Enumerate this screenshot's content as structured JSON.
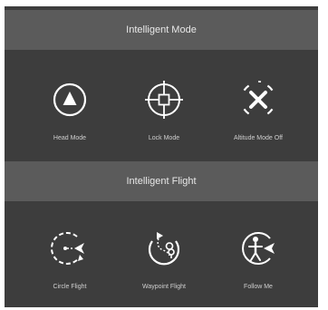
{
  "intelligent_mode": {
    "title": "Intelligent Mode",
    "items": [
      {
        "label": "Head Mode",
        "icon": "head-mode-icon"
      },
      {
        "label": "Lock Mode",
        "icon": "lock-mode-icon"
      },
      {
        "label": "Altitude Mode Off",
        "icon": "altitude-mode-off-icon"
      }
    ]
  },
  "intelligent_flight": {
    "title": "Intelligent Flight",
    "items": [
      {
        "label": "Circle Flight",
        "icon": "circle-flight-icon"
      },
      {
        "label": "Waypoint Flight",
        "icon": "waypoint-flight-icon"
      },
      {
        "label": "Follow Me",
        "icon": "follow-me-icon"
      }
    ]
  },
  "colors": {
    "panel_bg": "#3d3d3d",
    "header_bg": "#5b5b5b",
    "icon_stroke": "#ffffff",
    "label_text": "#cfcfcf"
  }
}
